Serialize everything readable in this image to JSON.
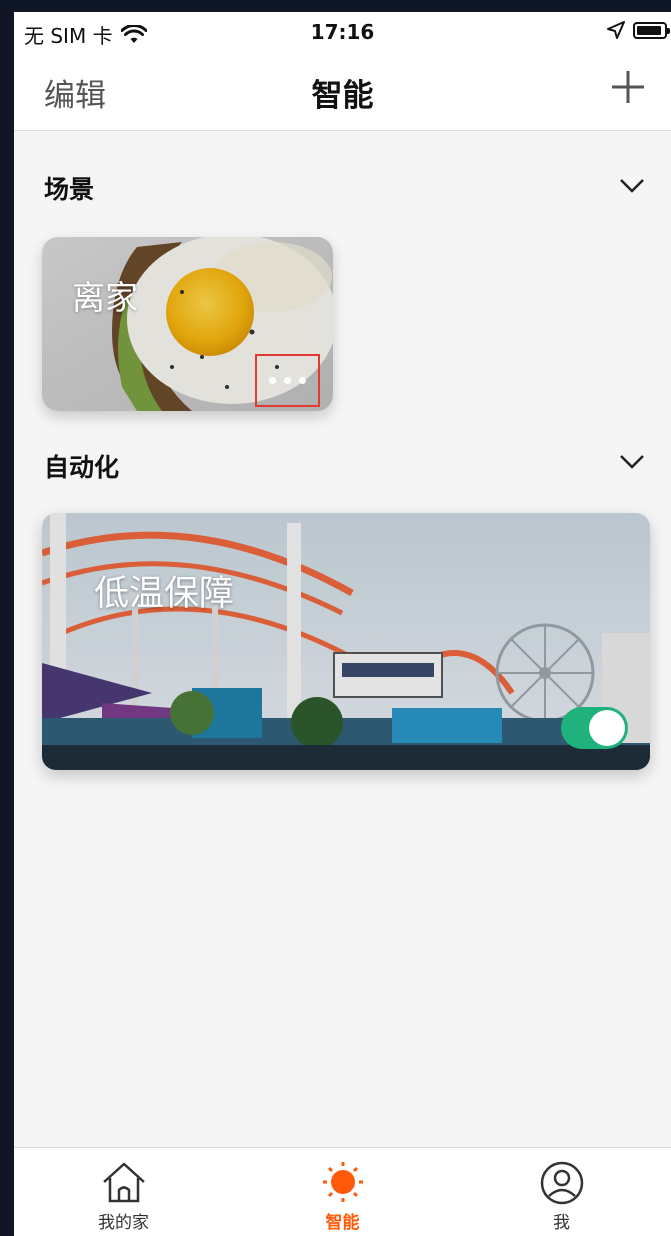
{
  "status_bar": {
    "carrier": "无 SIM 卡",
    "time": "17:16"
  },
  "nav": {
    "edit_label": "编辑",
    "title": "智能",
    "add_icon": "plus-icon"
  },
  "sections": {
    "scenes": {
      "title": "场景"
    },
    "automation": {
      "title": "自动化"
    }
  },
  "scene_cards": [
    {
      "name": "离家",
      "more_icon": "ellipsis-icon"
    }
  ],
  "automation_cards": [
    {
      "name": "低温保障",
      "enabled": true
    }
  ],
  "tabs": [
    {
      "label": "我的家",
      "icon": "home-icon",
      "active": false
    },
    {
      "label": "智能",
      "icon": "sun-icon",
      "active": true
    },
    {
      "label": "我",
      "icon": "person-icon",
      "active": false
    }
  ],
  "colors": {
    "accent": "#ff5a0a",
    "toggle_on": "#1fb27a",
    "highlight_box": "#e23a2e"
  }
}
